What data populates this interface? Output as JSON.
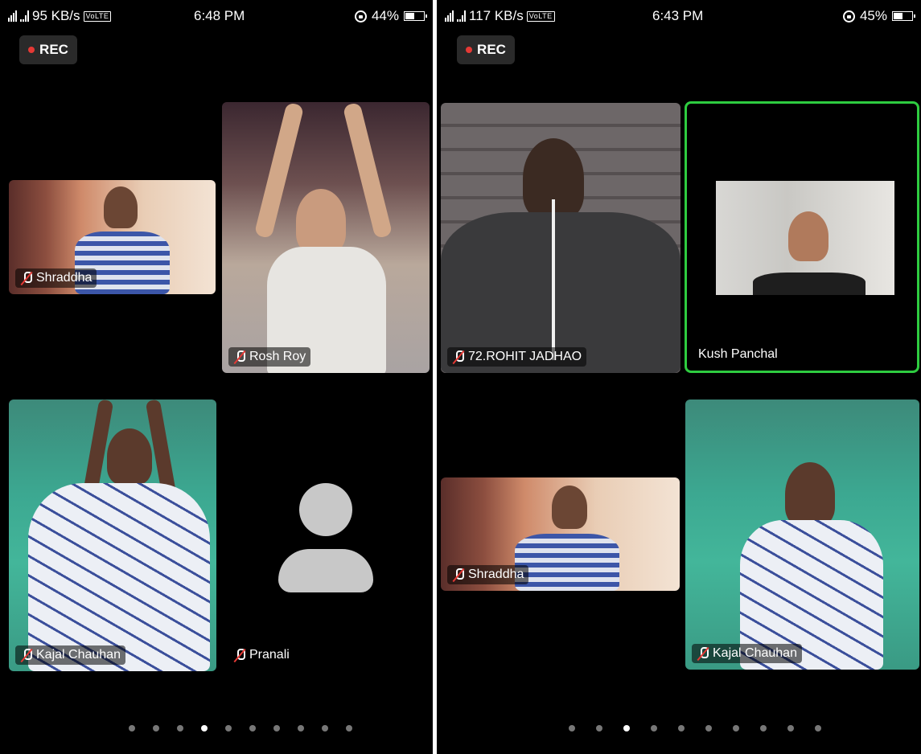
{
  "screens": [
    {
      "status": {
        "speed": "95 KB/s",
        "volte": "VoLTE",
        "time": "6:48 PM",
        "battery_text": "44%",
        "battery_level": 0.44
      },
      "rec_label": "REC",
      "participants": [
        {
          "name": "Shraddha",
          "muted": true
        },
        {
          "name": "Rosh Roy",
          "muted": true
        },
        {
          "name": "Kajal Chauhan",
          "muted": true
        },
        {
          "name": "Pranali",
          "muted": true,
          "video": false
        }
      ],
      "pages": {
        "count": 10,
        "active_index": 3
      }
    },
    {
      "status": {
        "speed": "117 KB/s",
        "volte": "VoLTE",
        "time": "6:43 PM",
        "battery_text": "45%",
        "battery_level": 0.45
      },
      "rec_label": "REC",
      "participants": [
        {
          "name": "72.ROHIT JADHAO",
          "muted": true
        },
        {
          "name": "Kush Panchal",
          "muted": false,
          "active_speaker": true
        },
        {
          "name": "Shraddha",
          "muted": true
        },
        {
          "name": "Kajal Chauhan",
          "muted": true
        }
      ],
      "pages": {
        "count": 10,
        "active_index": 2
      }
    }
  ],
  "colors": {
    "active_speaker_border": "#2ecc40",
    "rec_dot": "#e53935",
    "muted_slash": "#e53935"
  }
}
